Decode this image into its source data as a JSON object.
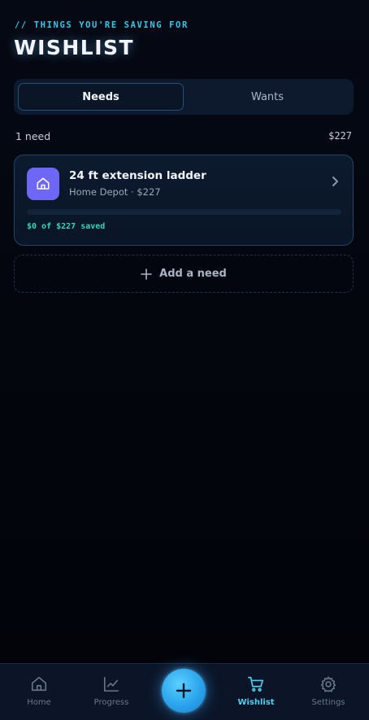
{
  "header": {
    "eyebrow": "// THINGS YOU'RE SAVING FOR",
    "title": "WISHLIST"
  },
  "segmented": {
    "needs_label": "Needs",
    "wants_label": "Wants",
    "active": "Needs"
  },
  "summary": {
    "count_label": "1 need",
    "total": "$227"
  },
  "items": [
    {
      "name": "24 ft extension ladder",
      "meta": "Home Depot · $227",
      "icon": "home-icon",
      "progress_fraction": 0,
      "saved_label": "$0 of $227 saved"
    }
  ],
  "add_button": {
    "label": "Add a need"
  },
  "tabbar": {
    "home": "Home",
    "progress": "Progress",
    "wishlist": "Wishlist",
    "settings": "Settings",
    "active": "Wishlist"
  },
  "colors": {
    "accent": "#37c6e8",
    "item_icon_bg": "#6e67f5",
    "saved_text": "#36d6b8"
  }
}
